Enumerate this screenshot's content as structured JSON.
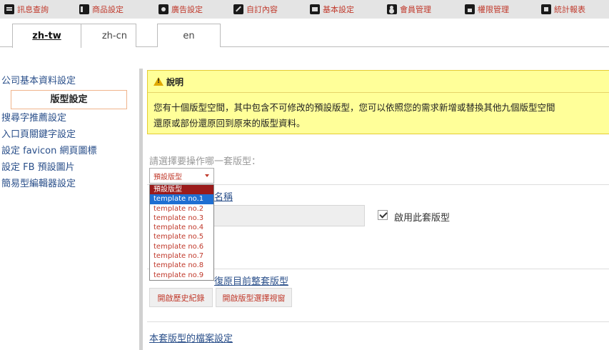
{
  "topnav": [
    {
      "label": "訊息查詢",
      "icon": "news-icon"
    },
    {
      "label": "商品設定",
      "icon": "goods-icon"
    },
    {
      "label": "廣告設定",
      "icon": "ads-icon"
    },
    {
      "label": "自訂內容",
      "icon": "custom-icon"
    },
    {
      "label": "基本設定",
      "icon": "basic-icon"
    },
    {
      "label": "會員管理",
      "icon": "member-icon"
    },
    {
      "label": "權限管理",
      "icon": "permission-icon"
    },
    {
      "label": "統計報表",
      "icon": "stats-icon"
    }
  ],
  "tabs": {
    "zh_tw": "zh-tw",
    "zh_cn": "zh-cn",
    "en": "en"
  },
  "sidebar": {
    "items": [
      "公司基本資料設定",
      "版型設定",
      "搜尋字推薦設定",
      "入口頁關鍵字設定",
      "設定 favicon 網頁圖標",
      "設定 FB 預設圖片",
      "簡易型編輯器設定"
    ],
    "active_index": 1
  },
  "notice": {
    "title": "說明",
    "line1": "您有十個版型空間，其中包含不可修改的預設版型，您可以依照您的需求新增或替換其他九個版型空間",
    "line2": "還原或部份還原回到原來的版型資料。"
  },
  "template_select": {
    "prompt": "請選擇要操作哪一套版型：",
    "selected": "預設版型",
    "options": [
      "預設版型",
      "template no.1",
      "template no.2",
      "template no.3",
      "template no.4",
      "template no.5",
      "template no.6",
      "template no.7",
      "template no.8",
      "template no.9"
    ],
    "hover_index": 1
  },
  "form": {
    "name_link": "名稱",
    "name_value": "",
    "enable_label": "啟用此套版型",
    "enable_checked": true,
    "restore_link": "復原目前整套版型",
    "history_button": "開啟歷史紀錄",
    "picker_button": "開啟版型選擇視窗",
    "file_settings_link": "本套版型的檔案設定"
  },
  "colors": {
    "accent_red": "#c0392b",
    "link_blue": "#2a4f8a",
    "notice_bg": "#ffff99",
    "menu_bg": "#e4e4e4"
  }
}
